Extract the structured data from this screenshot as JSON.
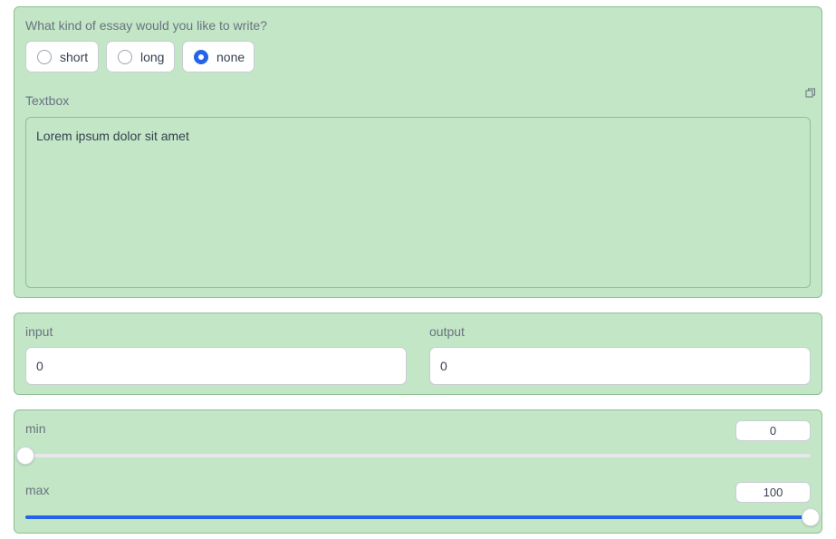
{
  "essay": {
    "question": "What kind of essay would you like to write?",
    "options": [
      "short",
      "long",
      "none"
    ],
    "selected": "none",
    "textbox_label": "Textbox",
    "textbox_value": "Lorem ipsum dolor sit amet"
  },
  "io": {
    "input_label": "input",
    "input_value": "0",
    "output_label": "output",
    "output_value": "0"
  },
  "range": {
    "min_label": "min",
    "min_value": "0",
    "max_label": "max",
    "max_value": "100",
    "slider_min": 0,
    "slider_max": 100
  },
  "colors": {
    "panel_bg": "#c2e6c6",
    "accent": "#2563eb"
  }
}
